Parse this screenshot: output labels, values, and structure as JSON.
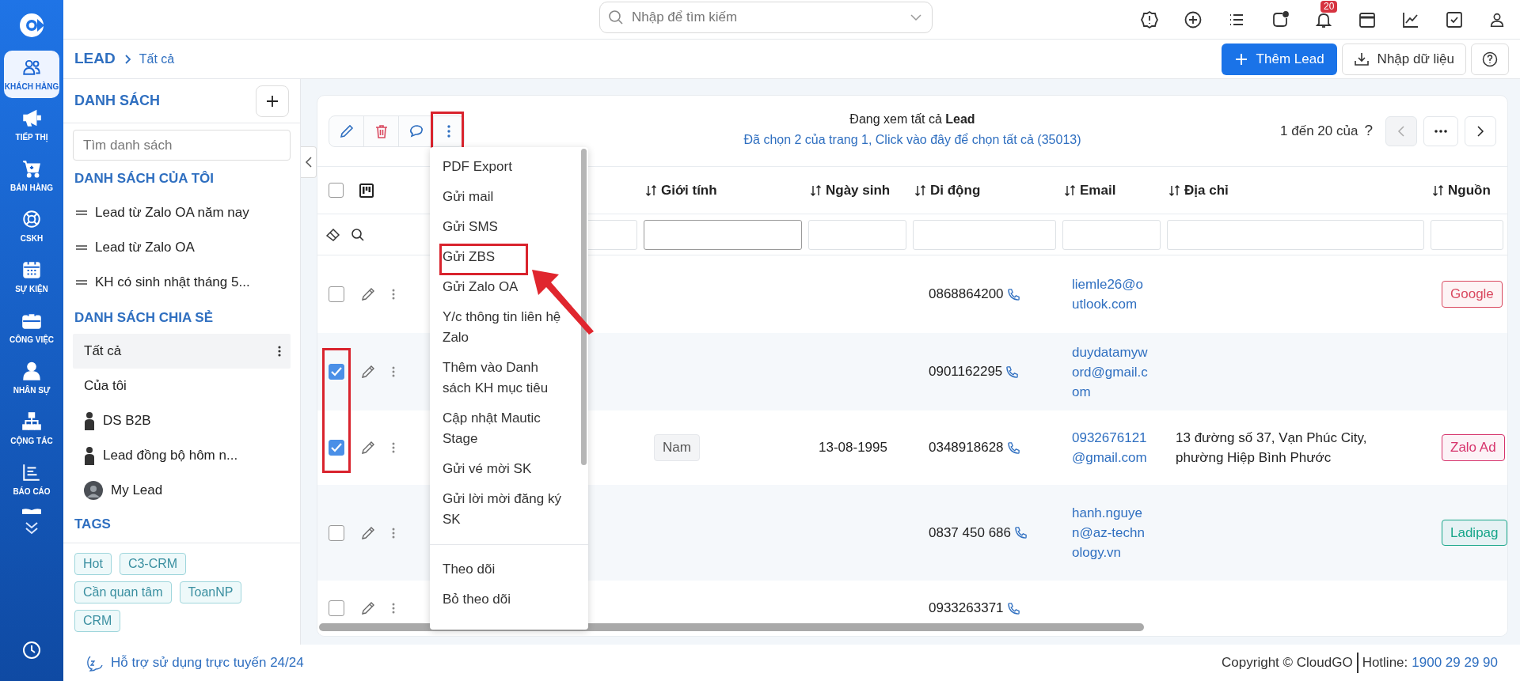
{
  "nav": {
    "items": [
      {
        "label": "KHÁCH HÀNG",
        "selected": true
      },
      {
        "label": "TIẾP THỊ",
        "selected": false
      },
      {
        "label": "BÁN HÀNG",
        "selected": false
      },
      {
        "label": "CSKH",
        "selected": false
      },
      {
        "label": "SỰ KIỆN",
        "selected": false
      },
      {
        "label": "CÔNG VIỆC",
        "selected": false
      },
      {
        "label": "NHÂN SỰ",
        "selected": false
      },
      {
        "label": "CỘNG TÁC",
        "selected": false
      },
      {
        "label": "BÁO CÁO",
        "selected": false
      }
    ]
  },
  "search": {
    "placeholder": "Nhập để tìm kiếm"
  },
  "notifications": {
    "count": "20"
  },
  "breadcrumb": [
    "LEAD",
    "Tất cả"
  ],
  "actions": [
    {
      "label": "Thêm Lead",
      "kind": "primary"
    },
    {
      "label": "Nhập dữ liệu",
      "kind": "import"
    }
  ],
  "lists_panel": {
    "title": "DANH SÁCH",
    "search_placeholder": "Tìm danh sách",
    "sections": [
      {
        "title": "DANH SÁCH CỦA TÔI",
        "items": [
          {
            "label": "Lead từ Zalo OA năm nay",
            "kind": "list",
            "selected": false
          },
          {
            "label": "Lead từ Zalo OA",
            "kind": "list",
            "selected": false
          },
          {
            "label": "KH có sinh nhật tháng 5...",
            "kind": "list",
            "selected": false
          }
        ]
      },
      {
        "title": "DANH SÁCH CHIA SẺ",
        "items": [
          {
            "label": "Tất cả",
            "kind": "plain",
            "selected": true
          },
          {
            "label": "Của tôi",
            "kind": "plain",
            "selected": false
          },
          {
            "label": "DS B2B",
            "kind": "person",
            "selected": false
          },
          {
            "label": "Lead đồng bộ hôm n...",
            "kind": "person",
            "selected": false
          },
          {
            "label": "My Lead",
            "kind": "avatar",
            "selected": false
          }
        ]
      }
    ],
    "tags_title": "TAGS",
    "tags": [
      "Hot",
      "C3-CRM",
      "Cần quan tâm",
      "ToanNP",
      "CRM"
    ]
  },
  "view": {
    "title": "Đang xem tất cả **Lead**",
    "selection_link": "Đã chọn 2 của trang 1, Click vào đây để chọn tất cả (35013)",
    "range": "1 đến 20 của",
    "total": "?",
    "prev_disabled": true,
    "more_highlighted": true
  },
  "menu": {
    "groups": [
      [
        {
          "label": "PDF Export",
          "highlighted": false
        },
        {
          "label": "Gửi mail",
          "highlighted": false
        },
        {
          "label": "Gửi SMS",
          "highlighted": false
        },
        {
          "label": "Gửi ZBS",
          "highlighted": true
        },
        {
          "label": "Gửi Zalo OA",
          "highlighted": false
        },
        {
          "label": "Y/c thông tin liên hệ Zalo",
          "highlighted": false
        },
        {
          "label": "Thêm vào Danh sách KH mục tiêu",
          "highlighted": false
        },
        {
          "label": "Cập nhật Mautic Stage",
          "highlighted": false
        },
        {
          "label": "Gửi vé mời SK",
          "highlighted": false
        },
        {
          "label": "Gửi lời mời đăng ký SK",
          "highlighted": false
        }
      ],
      [
        {
          "label": "Theo dõi",
          "highlighted": false
        },
        {
          "label": "Bỏ theo dõi",
          "highlighted": false
        }
      ]
    ]
  },
  "table": {
    "select_all_checked": false,
    "columns": [
      {
        "label": "Giới tính"
      },
      {
        "label": "Ngày sinh"
      },
      {
        "label": "Di động"
      },
      {
        "label": "Email"
      },
      {
        "label": "Địa chỉ"
      },
      {
        "label": "Nguồn"
      }
    ],
    "rows": [
      {
        "checked": false,
        "checkbox_highlighted": false,
        "mobile": "0868864200",
        "email": "liemle26@outlook.com",
        "source": {
          "label": "Google",
          "color": "#d9485f"
        }
      },
      {
        "checked": true,
        "checkbox_highlighted": true,
        "mobile": "0901162295",
        "email": "duydatamyword@gmail.com"
      },
      {
        "checked": true,
        "checkbox_highlighted": true,
        "gender": "Nam",
        "birthday": "13-08-1995",
        "mobile": "0348918628",
        "email": "0932676121@gmail.com",
        "address": "13 đường số 37, Vạn Phúc City, phường Hiệp Bình Phước",
        "source": {
          "label": "Zalo Ad",
          "color": "#d6336c"
        }
      },
      {
        "checked": false,
        "checkbox_highlighted": false,
        "mobile": "0837 450 686",
        "email": "hanh.nguyen@az-technology.vn",
        "source": {
          "label": "Ladipag",
          "color": "#17a589"
        }
      },
      {
        "checked": false,
        "checkbox_highlighted": false,
        "mobile": "0933263371"
      }
    ]
  },
  "annotation_arrow": true,
  "footer": {
    "support": "Hỗ trợ sử dụng trực tuyến 24/24",
    "copyright": "Copyright © CloudGO",
    "hotline_label": "Hotline:",
    "hotline": "1900 29 29 90"
  }
}
